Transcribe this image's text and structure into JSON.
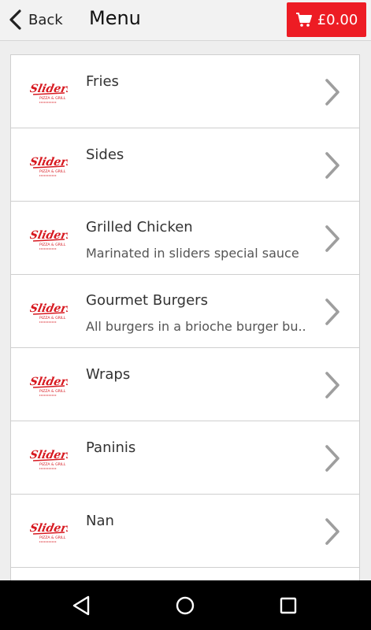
{
  "header": {
    "back_label": "Back",
    "title": "Menu",
    "cart_total": "£0.00"
  },
  "logo": {
    "brand_text": "Sliders",
    "tagline": "PIZZA & GRILL"
  },
  "menu_items": [
    {
      "title": "Fries",
      "subtitle": ""
    },
    {
      "title": "Sides",
      "subtitle": ""
    },
    {
      "title": "Grilled Chicken",
      "subtitle": "Marinated in sliders special sauce"
    },
    {
      "title": "Gourmet Burgers",
      "subtitle": "All burgers in a brioche burger bu.."
    },
    {
      "title": "Wraps",
      "subtitle": ""
    },
    {
      "title": "Paninis",
      "subtitle": ""
    },
    {
      "title": "Nan",
      "subtitle": ""
    },
    {
      "title": "",
      "subtitle": ""
    }
  ],
  "colors": {
    "accent": "#ed1c24",
    "chevron": "#9e9e9e",
    "logo_red": "#d71920"
  },
  "icons": {
    "back": "chevron-left-icon",
    "cart": "shopping-cart-icon",
    "row_arrow": "chevron-right-icon",
    "nav_back": "triangle-back-icon",
    "nav_home": "circle-home-icon",
    "nav_recents": "square-recents-icon"
  }
}
